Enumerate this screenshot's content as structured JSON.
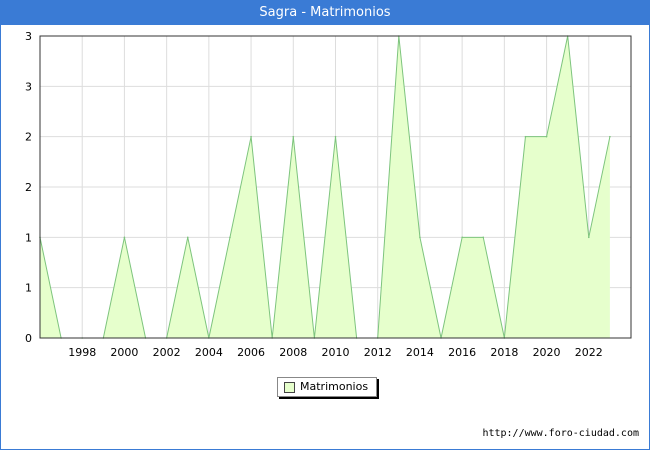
{
  "chart_data": {
    "type": "area",
    "title": "Sagra - Matrimonios",
    "x": [
      1996,
      1997,
      1998,
      1999,
      2000,
      2001,
      2002,
      2003,
      2004,
      2005,
      2006,
      2007,
      2008,
      2009,
      2010,
      2011,
      2012,
      2013,
      2014,
      2015,
      2016,
      2017,
      2018,
      2019,
      2020,
      2021,
      2022,
      2023
    ],
    "series": [
      {
        "name": "Matrimonios",
        "values": [
          1,
          0,
          0,
          0,
          1,
          0,
          0,
          1,
          0,
          1,
          2,
          0,
          2,
          0,
          2,
          0,
          0,
          3,
          1,
          0,
          1,
          1,
          0,
          2,
          2,
          3,
          1,
          2
        ]
      }
    ],
    "x_ticks": [
      "1998",
      "2000",
      "2002",
      "2004",
      "2006",
      "2008",
      "2010",
      "2012",
      "2014",
      "2016",
      "2018",
      "2020",
      "2022"
    ],
    "y_tick_labels": [
      "0",
      "1",
      "1",
      "2",
      "2",
      "3",
      "3"
    ],
    "ylim": [
      0,
      3
    ],
    "grid": true,
    "legend_position": "bottom-center",
    "colors": {
      "fill": "#e6ffcc",
      "line": "#7dc47d",
      "header": "#3a7bd5",
      "grid": "#dddddd"
    }
  },
  "source": "http://www.foro-ciudad.com"
}
